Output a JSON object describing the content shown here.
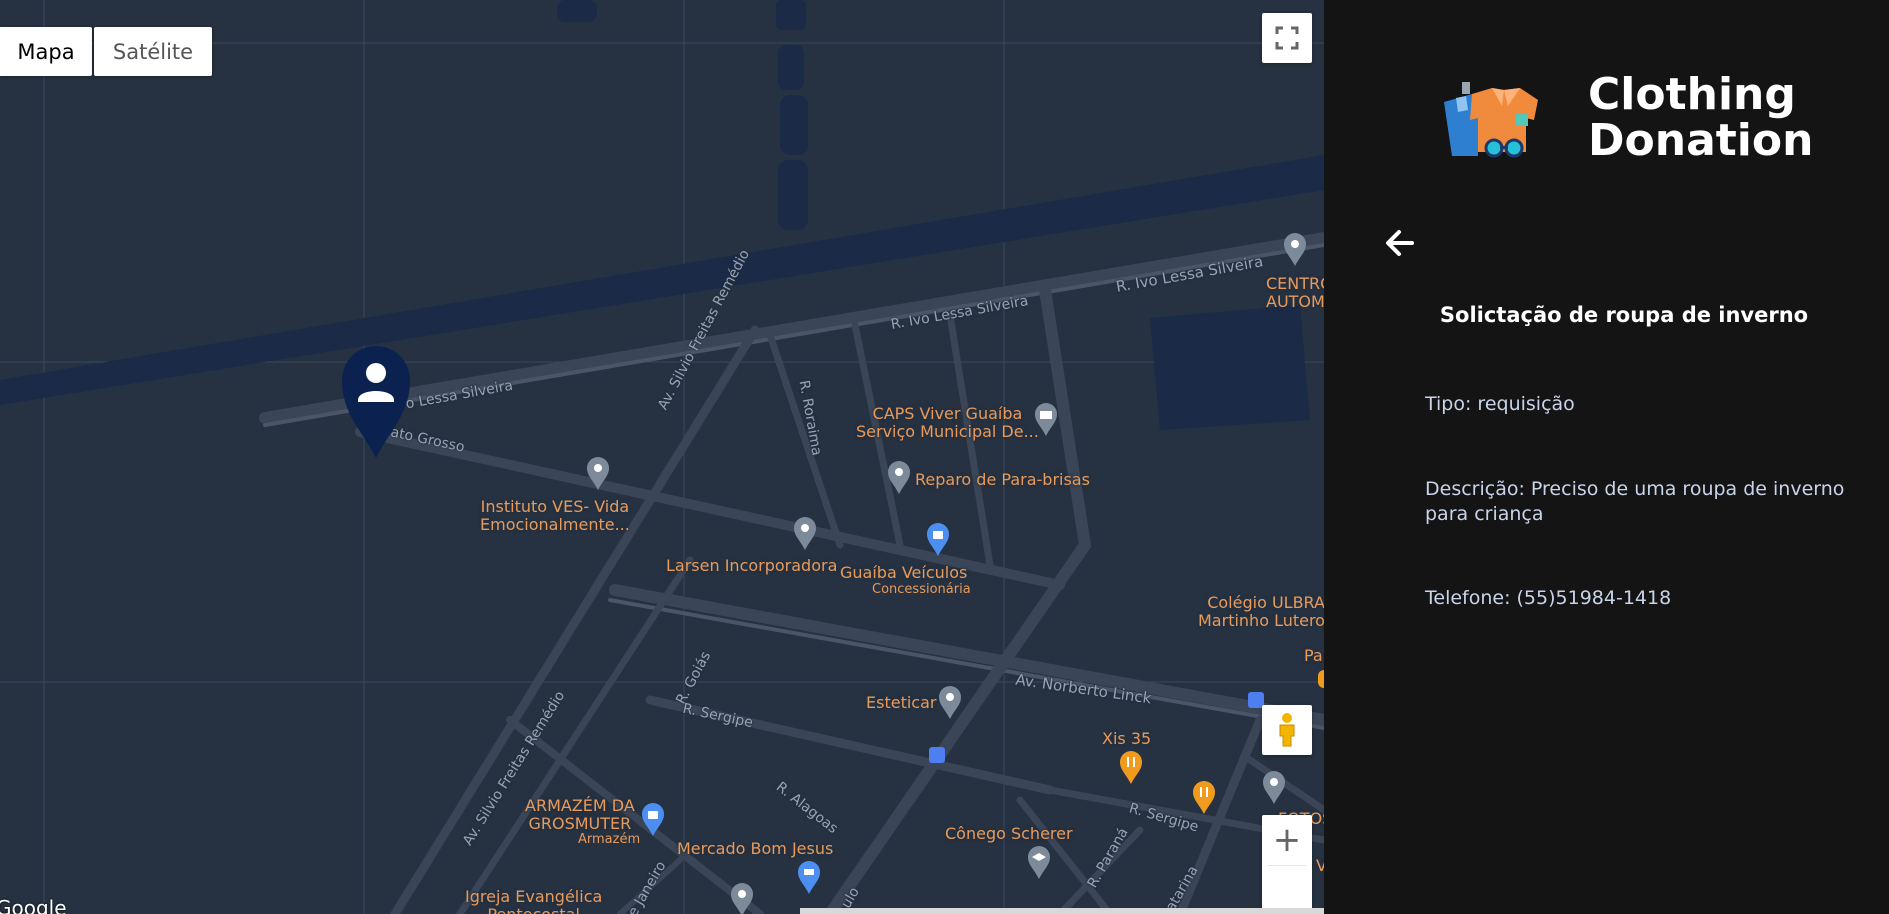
{
  "map": {
    "type_buttons": [
      {
        "label": "Mapa",
        "selected": true
      },
      {
        "label": "Satélite",
        "selected": false
      }
    ],
    "fullscreen_icon": "fullscreen-icon",
    "pegman_icon": "pegman-icon",
    "zoom_in_label": "+",
    "google_logo": "Google",
    "roads": {
      "ivo_lessa_1": "R. Ivo Lessa Silveira",
      "ivo_lessa_2": "R. Ivo Lessa Silveira",
      "ivo_lessa_3": "o Lessa Silveira",
      "mato_grosso": "ato Grosso",
      "silvio_1": "Av. Silvio Freitas Remédio",
      "silvio_2": "Av. Silvio Freitas Remédio",
      "roraima": "R. Roraima",
      "goias": "R. Goiás",
      "sergipe_1": "R. Sergipe",
      "sergipe_2": "R. Sergipe",
      "alagoas": "R. Alagoas",
      "norberto": "Av. Norberto Linck",
      "parana": "R. Paraná",
      "catarina": "Catarina",
      "janeiro": "de Janeiro",
      "paulo": "ulo"
    },
    "places": {
      "centro": "CENTRO\nAUTOM",
      "caps": "CAPS Viver Guaíba\nServiço Municipal De...",
      "reparo": "Reparo de Para-brisas",
      "instituto": "Instituto VES- Vida\nEmocionalmente...",
      "larsen": "Larsen Incorporadora",
      "guaiba": "Guaíba Veículos",
      "guaiba_sub": "Concessionária",
      "ulbra": "Colégio ULBRA\nMartinho Lutero",
      "pa": "Pa",
      "esteticar": "Esteticar",
      "xis": "Xis 35",
      "armazem": "ARMAZÉM DA\nGROSMUTER",
      "armazem_sub": "Armazém",
      "mercado": "Mercado Bom Jesus",
      "conego": "Cônego Scherer",
      "igreja": "Igreja Evangélica\nPentecostal",
      "fotos": "FOTOS\nGa",
      "v": "V"
    },
    "user_marker_icon": "user-icon"
  },
  "panel": {
    "brand_line1": "Clothing",
    "brand_line2": "Donation",
    "logo_icon": "clothing-logo-icon",
    "back_icon": "arrow-left-icon",
    "title": "Solictação de roupa de inverno",
    "tipo": "Tipo: requisição",
    "descricao": "Descrição: Preciso de uma roupa de inverno para criança",
    "telefone": "Telefone: (55)51984-1418"
  },
  "colors": {
    "map_bg": "#263241",
    "road": "#3a4657",
    "water": "#1a2a47",
    "poi_text": "#e89a5a",
    "marker": "#0b2150",
    "panel_bg": "#141414"
  }
}
